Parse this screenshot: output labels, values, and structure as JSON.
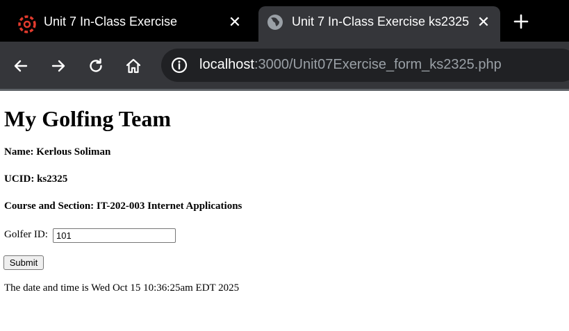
{
  "tabs": [
    {
      "title": "Unit 7 In-Class Exercise",
      "icon": "canvas-logo-icon",
      "active": false
    },
    {
      "title": "Unit 7 In-Class Exercise ks2325",
      "icon": "globe-icon",
      "active": true
    }
  ],
  "address_bar": {
    "host": "localhost",
    "rest": ":3000/Unit07Exercise_form_ks2325.php"
  },
  "page": {
    "heading": "My Golfing Team",
    "name_line": "Name: Kerlous Soliman",
    "ucid_line": "UCID: ks2325",
    "course_line": "Course and Section: IT-202-003 Internet Applications",
    "golfer_label": "Golfer ID:",
    "golfer_value": "101",
    "submit_label": "Submit",
    "datetime_line": "The date and time is Wed Oct 15 10:36:25am EDT 2025"
  },
  "colors": {
    "tab_strip": "#000000",
    "toolbar": "#35363a",
    "omnibox": "#202124",
    "canvas_red": "#e33b2e"
  }
}
